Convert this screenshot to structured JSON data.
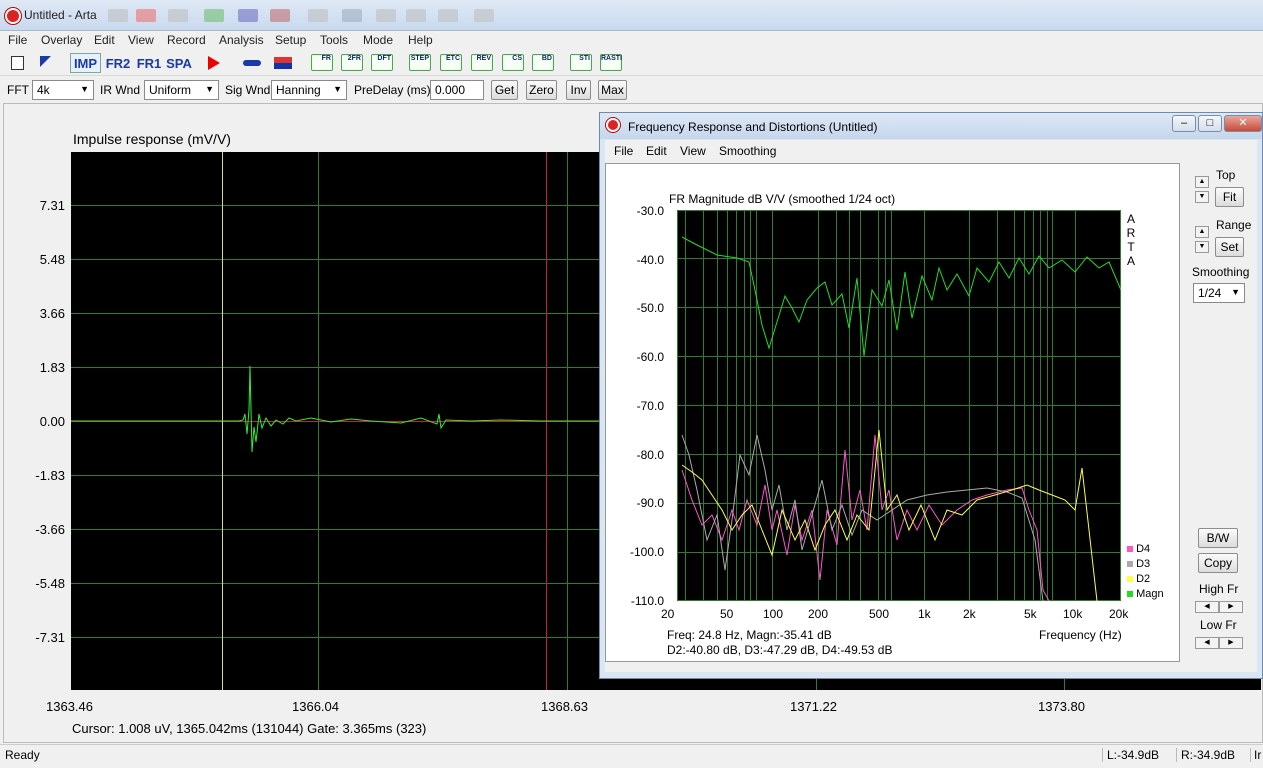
{
  "window": {
    "title": "Untitled - Arta"
  },
  "menu": [
    "File",
    "Overlay",
    "Edit",
    "View",
    "Record",
    "Analysis",
    "Setup",
    "Tools",
    "Mode",
    "Help"
  ],
  "toolbar": {
    "imp": "IMP",
    "fr2": "FR2",
    "fr1": "FR1",
    "spa": "SPA",
    "icons": [
      "FR",
      "2FR",
      "DFT",
      "STEP",
      "ETC",
      "REV",
      "CS",
      "BD",
      "STI",
      "RASTI"
    ]
  },
  "options": {
    "fft_label": "FFT",
    "fft_value": "4k",
    "irwnd_label": "IR Wnd",
    "irwnd_value": "Uniform",
    "sigwnd_label": "Sig Wnd",
    "sigwnd_value": "Hanning",
    "predelay_label": "PreDelay (ms)",
    "predelay_value": "0.000",
    "get": "Get",
    "zero": "Zero",
    "inv": "Inv",
    "max": "Max"
  },
  "impulse": {
    "title": "Impulse response (mV/V)",
    "y_ticks": [
      "7.31",
      "5.48",
      "3.66",
      "1.83",
      "0.00",
      "-1.83",
      "-3.66",
      "-5.48",
      "-7.31"
    ],
    "x_ticks": [
      "1363.46",
      "1366.04",
      "1368.63",
      "1371.22",
      "1373.80"
    ],
    "cursor": "Cursor: 1.008 uV, 1365.042ms (131044)  Gate: 3.365ms (323)"
  },
  "status": {
    "ready": "Ready",
    "left": "L:-34.9dB",
    "right": "R:-34.9dB",
    "extra": "Ir"
  },
  "fr_window": {
    "title": "Frequency Response and Distortions (Untitled)",
    "menu": [
      "File",
      "Edit",
      "View",
      "Smoothing"
    ],
    "plot_title": "FR Magnitude dB V/V (smoothed 1/24 oct)",
    "brand": [
      "A",
      "R",
      "T",
      "A"
    ],
    "y_ticks": [
      "-30.0",
      "-40.0",
      "-50.0",
      "-60.0",
      "-70.0",
      "-80.0",
      "-90.0",
      "-100.0",
      "-110.0"
    ],
    "x_ticks": [
      "20",
      "50",
      "100",
      "200",
      "500",
      "1k",
      "2k",
      "5k",
      "10k",
      "20k"
    ],
    "x_unit": "Frequency (Hz)",
    "readout1": "Freq: 24.8 Hz, Magn:-35.41 dB",
    "readout2": "D2:-40.80 dB, D3:-47.29 dB, D4:-49.53 dB",
    "legend": [
      {
        "name": "D4",
        "color": "#ff55cc"
      },
      {
        "name": "D3",
        "color": "#aaaaaa"
      },
      {
        "name": "D2",
        "color": "#ffff44"
      },
      {
        "name": "Magn",
        "color": "#22dd22"
      }
    ],
    "side": {
      "top": "Top",
      "fit": "Fit",
      "range": "Range",
      "set": "Set",
      "smoothing": "Smoothing",
      "smooth_value": "1/24",
      "bw": "B/W",
      "copy": "Copy",
      "high_fr": "High Fr",
      "low_fr": "Low Fr"
    }
  },
  "colors": {
    "trace": "#33ee33",
    "grid": "#2e7d2e",
    "marker_red": "#cc2222",
    "marker_yellow": "#dddd88"
  }
}
